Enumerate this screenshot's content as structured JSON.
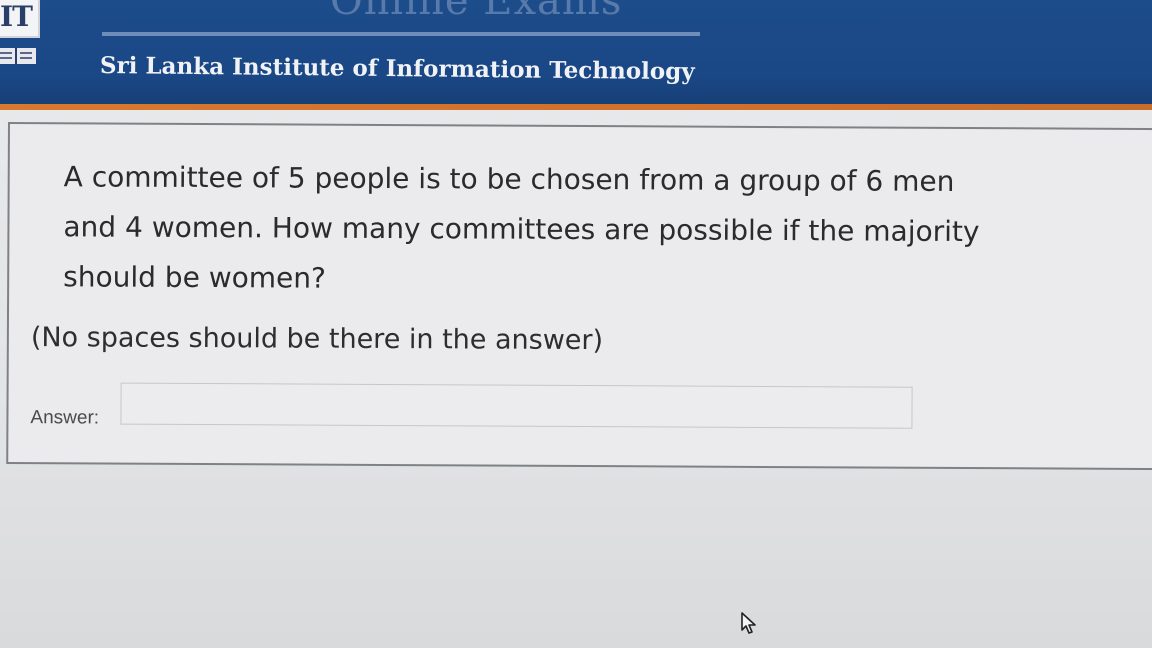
{
  "header": {
    "logo_text": "IT",
    "exams_title": "Online Exams",
    "institute_name": "Sri Lanka Institute of Information Technology",
    "colors": {
      "banner": "#1a4785",
      "accent_line": "#d9792f"
    }
  },
  "question": {
    "text": "A committee of 5 people is to be chosen from a group of 6 men and 4 women. How many committees are possible if the majority should be women?",
    "note": "(No spaces should be there in the answer)",
    "answer_label": "Answer:",
    "answer_value": ""
  },
  "icons": {
    "cursor": "mouse-pointer-icon"
  }
}
